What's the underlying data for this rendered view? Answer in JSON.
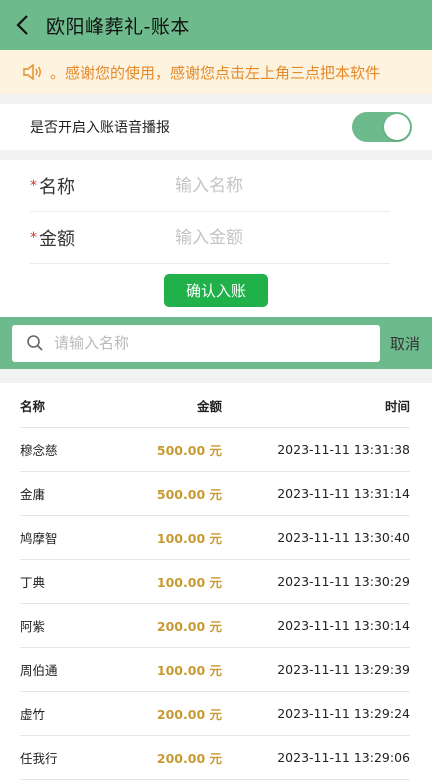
{
  "header": {
    "title": "欧阳峰葬礼-账本"
  },
  "notice": {
    "text": "。感谢您的使用，感谢您点击左上角三点把本软件"
  },
  "voice_toggle": {
    "label": "是否开启入账语音播报",
    "enabled": true
  },
  "form": {
    "required_mark": "*",
    "name_label": "名称",
    "name_placeholder": "输入名称",
    "amount_label": "金额",
    "amount_placeholder": "输入金额",
    "confirm_label": "确认入账"
  },
  "search": {
    "placeholder": "请输入名称",
    "cancel_label": "取消"
  },
  "table": {
    "columns": [
      "名称",
      "金额",
      "时间"
    ],
    "rows": [
      {
        "name": "穆念慈",
        "amount": "500.00 元",
        "time": "2023-11-11 13:31:38"
      },
      {
        "name": "金庸",
        "amount": "500.00 元",
        "time": "2023-11-11 13:31:14"
      },
      {
        "name": "鸠摩智",
        "amount": "100.00 元",
        "time": "2023-11-11 13:30:40"
      },
      {
        "name": "丁典",
        "amount": "100.00 元",
        "time": "2023-11-11 13:30:29"
      },
      {
        "name": "阿紫",
        "amount": "200.00 元",
        "time": "2023-11-11 13:30:14"
      },
      {
        "name": "周伯通",
        "amount": "100.00 元",
        "time": "2023-11-11 13:29:39"
      },
      {
        "name": "虚竹",
        "amount": "200.00 元",
        "time": "2023-11-11 13:29:24"
      },
      {
        "name": "任我行",
        "amount": "200.00 元",
        "time": "2023-11-11 13:29:06"
      }
    ]
  },
  "colors": {
    "accent": "#6dbb8c",
    "button": "#21b14b",
    "amount": "#c89a32",
    "notice_text": "#e58a2a"
  }
}
